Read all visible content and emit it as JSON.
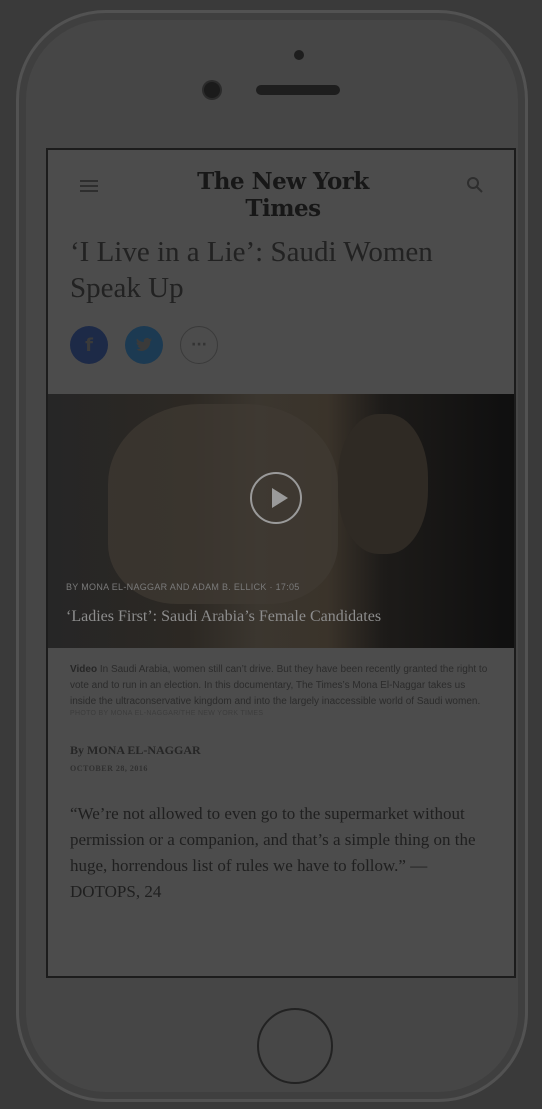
{
  "header": {
    "logo": "The New York Times",
    "menu_icon": "hamburger-menu-icon",
    "search_icon": "search-icon"
  },
  "article": {
    "headline": "‘I Live in a Lie’: Saudi Women Speak Up",
    "share": {
      "facebook": "f",
      "twitter": "t",
      "more": "···"
    },
    "video": {
      "byline": "By MONA EL-NAGGAR and ADAM B. ELLICK · 17:05",
      "title": "‘Ladies First’: Saudi Arabia’s Female Candidates",
      "play_icon": "play-icon"
    },
    "caption_label": "Video",
    "caption_text": "In Saudi Arabia, women still can’t drive. But they have been recently granted the right to vote and to run in an election. In this documentary, The Times’s Mona El-Naggar takes us inside the ultraconservative kingdom and into the largely inaccessible world of Saudi women.",
    "credit": "Photo by Mona El-Naggar/The New York Times",
    "byline": "By MONA EL-NAGGAR",
    "date": "October 28, 2016",
    "quote": "“We’re not allowed to even go to the supermarket without permission or a companion, and that’s a simple thing on the huge, horrendous list of rules we have to follow.” — DOTOPS, 24"
  },
  "colors": {
    "overlay_background": "#3a3a3a",
    "facebook": "#1d2a47",
    "twitter": "#1c3a52"
  }
}
